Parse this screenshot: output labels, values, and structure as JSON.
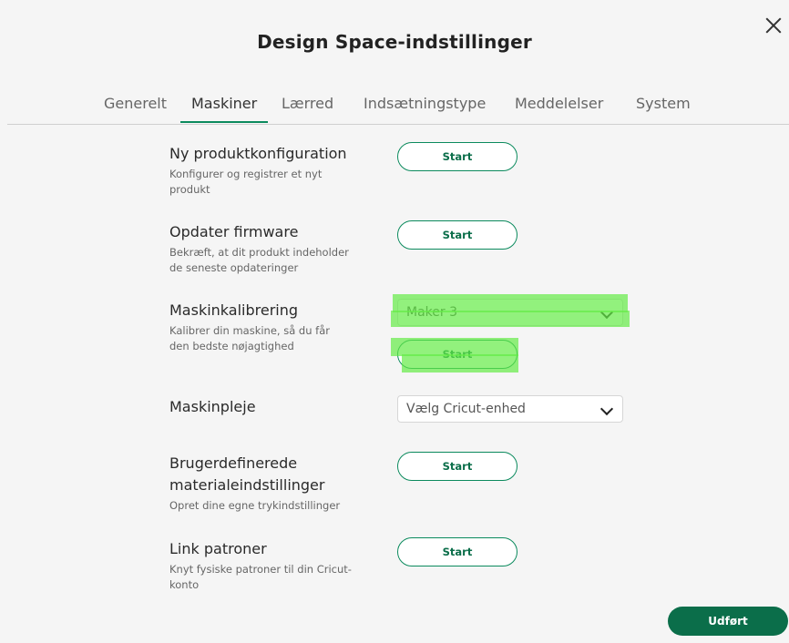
{
  "dialog": {
    "title": "Design Space-indstillinger"
  },
  "tabs": [
    {
      "label": "Generelt"
    },
    {
      "label": "Maskiner"
    },
    {
      "label": "Lærred"
    },
    {
      "label": "Indsætningstype"
    },
    {
      "label": "Meddelelser"
    },
    {
      "label": "System"
    }
  ],
  "active_tab": "Maskiner",
  "settings": [
    {
      "title": "Ny produktkonfiguration",
      "desc": "Konfigurer og registrer et nyt produkt",
      "button": "Start"
    },
    {
      "title": "Opdater firmware",
      "desc": "Bekræft, at dit produkt indeholder de seneste opdateringer",
      "button": "Start"
    },
    {
      "title": "Maskinkalibrering",
      "desc": "Kalibrer din maskine, så du får den bedste nøjagtighed",
      "select_value": "Maker 3",
      "button": "Start"
    },
    {
      "title": "Maskinpleje",
      "select_placeholder": "Vælg Cricut-enhed"
    },
    {
      "title": "Brugerdefinerede materialeindstillinger",
      "desc": "Opret dine egne trykindstillinger",
      "button": "Start"
    },
    {
      "title": "Link patroner",
      "desc": "Knyt fysiske patroner til din Cricut-konto",
      "button": "Start"
    }
  ],
  "footer": {
    "done_label": "Udført"
  },
  "colors": {
    "accent": "#0b8a5d",
    "accent_dark": "#0b6e4a",
    "highlight": "#64eb46"
  }
}
